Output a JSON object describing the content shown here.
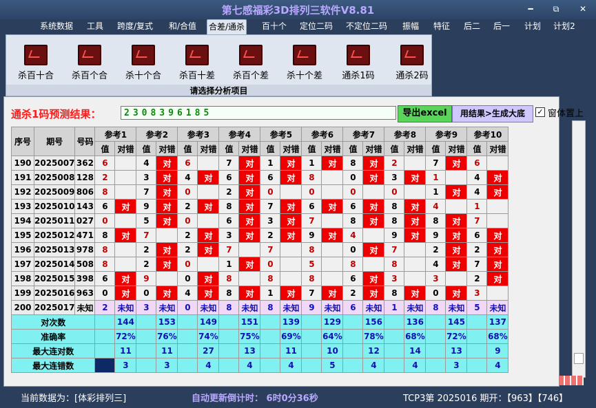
{
  "window": {
    "title": "第七感福彩3D排列三软件V8.81",
    "minimize": "━",
    "maximize": "⧉",
    "close": "✕"
  },
  "menu": [
    "系统数据",
    "工具",
    "跨度/复式",
    "和/合值",
    "合差/通杀",
    "百十个",
    "定位二码",
    "不定位二码",
    "振幅",
    "特征",
    "后二",
    "后一",
    "计划",
    "计划2"
  ],
  "active_menu": "合差/通杀",
  "tools": [
    "杀百十合",
    "杀百个合",
    "杀十个合",
    "杀百十差",
    "杀百个差",
    "杀十个差",
    "通杀1码",
    "通杀2码"
  ],
  "ribbon_caption": "请选择分析项目",
  "result": {
    "label": "通杀1码预测结果：",
    "value": "2308396185"
  },
  "buttons": {
    "excel": "导出excel",
    "generate": "用结果>生成大底"
  },
  "checkbox": {
    "label": "窗体置上",
    "checked": "✓"
  },
  "table": {
    "headers": {
      "seq": "序号",
      "period": "期号",
      "number": "号码",
      "refs": [
        "参考1",
        "参考2",
        "参考3",
        "参考4",
        "参考5",
        "参考6",
        "参考7",
        "参考8",
        "参考9",
        "参考10"
      ],
      "val": "值",
      "hit": "对错"
    },
    "rows": [
      {
        "seq": "190",
        "period": "2025007",
        "num": "362",
        "cells": [
          [
            "6",
            ""
          ],
          [
            "4",
            "对"
          ],
          [
            "6",
            ""
          ],
          [
            "7",
            "对"
          ],
          [
            "1",
            "对"
          ],
          [
            "1",
            "对"
          ],
          [
            "8",
            "对"
          ],
          [
            "2",
            ""
          ],
          [
            "7",
            "对"
          ],
          [
            "6",
            ""
          ]
        ]
      },
      {
        "seq": "191",
        "period": "2025008",
        "num": "128",
        "cells": [
          [
            "2",
            ""
          ],
          [
            "3",
            "对"
          ],
          [
            "4",
            "对"
          ],
          [
            "6",
            "对"
          ],
          [
            "6",
            "对"
          ],
          [
            "8",
            ""
          ],
          [
            "0",
            "对"
          ],
          [
            "3",
            "对"
          ],
          [
            "1",
            ""
          ],
          [
            "4",
            "对"
          ]
        ]
      },
      {
        "seq": "192",
        "period": "2025009",
        "num": "806",
        "cells": [
          [
            "8",
            ""
          ],
          [
            "7",
            "对"
          ],
          [
            "0",
            ""
          ],
          [
            "2",
            "对"
          ],
          [
            "0",
            ""
          ],
          [
            "0",
            ""
          ],
          [
            "0",
            ""
          ],
          [
            "0",
            ""
          ],
          [
            "1",
            "对"
          ],
          [
            "4",
            "对"
          ]
        ]
      },
      {
        "seq": "193",
        "period": "2025010",
        "num": "143",
        "cells": [
          [
            "6",
            "对"
          ],
          [
            "9",
            "对"
          ],
          [
            "2",
            "对"
          ],
          [
            "8",
            "对"
          ],
          [
            "7",
            "对"
          ],
          [
            "6",
            "对"
          ],
          [
            "6",
            "对"
          ],
          [
            "8",
            "对"
          ],
          [
            "4",
            ""
          ],
          [
            "1",
            ""
          ]
        ]
      },
      {
        "seq": "194",
        "period": "2025011",
        "num": "027",
        "cells": [
          [
            "0",
            ""
          ],
          [
            "5",
            "对"
          ],
          [
            "0",
            ""
          ],
          [
            "6",
            "对"
          ],
          [
            "3",
            "对"
          ],
          [
            "7",
            ""
          ],
          [
            "8",
            "对"
          ],
          [
            "8",
            "对"
          ],
          [
            "8",
            "对"
          ],
          [
            "7",
            ""
          ]
        ]
      },
      {
        "seq": "195",
        "period": "2025012",
        "num": "471",
        "cells": [
          [
            "8",
            "对"
          ],
          [
            "7",
            ""
          ],
          [
            "2",
            "对"
          ],
          [
            "3",
            "对"
          ],
          [
            "2",
            "对"
          ],
          [
            "9",
            "对"
          ],
          [
            "4",
            ""
          ],
          [
            "9",
            "对"
          ],
          [
            "9",
            "对"
          ],
          [
            "6",
            "对"
          ]
        ]
      },
      {
        "seq": "196",
        "period": "2025013",
        "num": "978",
        "cells": [
          [
            "8",
            ""
          ],
          [
            "2",
            "对"
          ],
          [
            "2",
            "对"
          ],
          [
            "7",
            ""
          ],
          [
            "7",
            ""
          ],
          [
            "8",
            ""
          ],
          [
            "0",
            "对"
          ],
          [
            "7",
            ""
          ],
          [
            "2",
            "对"
          ],
          [
            "2",
            "对"
          ]
        ]
      },
      {
        "seq": "197",
        "period": "2025014",
        "num": "508",
        "cells": [
          [
            "8",
            ""
          ],
          [
            "2",
            "对"
          ],
          [
            "0",
            ""
          ],
          [
            "1",
            "对"
          ],
          [
            "0",
            ""
          ],
          [
            "5",
            ""
          ],
          [
            "8",
            ""
          ],
          [
            "8",
            ""
          ],
          [
            "4",
            "对"
          ],
          [
            "7",
            "对"
          ]
        ]
      },
      {
        "seq": "198",
        "period": "2025015",
        "num": "398",
        "cells": [
          [
            "6",
            "对"
          ],
          [
            "9",
            ""
          ],
          [
            "0",
            "对"
          ],
          [
            "8",
            ""
          ],
          [
            "8",
            ""
          ],
          [
            "8",
            ""
          ],
          [
            "6",
            "对"
          ],
          [
            "3",
            ""
          ],
          [
            "3",
            ""
          ],
          [
            "2",
            "对"
          ]
        ]
      },
      {
        "seq": "199",
        "period": "2025016",
        "num": "963",
        "cells": [
          [
            "0",
            "对"
          ],
          [
            "0",
            "对"
          ],
          [
            "4",
            "对"
          ],
          [
            "8",
            "对"
          ],
          [
            "1",
            "对"
          ],
          [
            "7",
            "对"
          ],
          [
            "2",
            "对"
          ],
          [
            "8",
            "对"
          ],
          [
            "0",
            "对"
          ],
          [
            "3",
            ""
          ]
        ]
      }
    ],
    "predict": {
      "seq": "200",
      "period": "2025017",
      "num": "未知",
      "cells": [
        [
          "2",
          "未知"
        ],
        [
          "3",
          "未知"
        ],
        [
          "0",
          "未知"
        ],
        [
          "8",
          "未知"
        ],
        [
          "8",
          "未知"
        ],
        [
          "9",
          "未知"
        ],
        [
          "6",
          "未知"
        ],
        [
          "1",
          "未知"
        ],
        [
          "8",
          "未知"
        ],
        [
          "5",
          "未知"
        ]
      ]
    },
    "stats": [
      {
        "label": "对次数",
        "values": [
          "144",
          "153",
          "149",
          "151",
          "139",
          "129",
          "156",
          "136",
          "145",
          "137"
        ]
      },
      {
        "label": "准确率",
        "values": [
          "72%",
          "76%",
          "74%",
          "75%",
          "69%",
          "64%",
          "78%",
          "68%",
          "72%",
          "68%"
        ]
      },
      {
        "label": "最大连对数",
        "values": [
          "11",
          "11",
          "27",
          "13",
          "11",
          "10",
          "12",
          "14",
          "13",
          "9"
        ]
      },
      {
        "label": "最大连错数",
        "values": [
          "3",
          "3",
          "4",
          "4",
          "4",
          "5",
          "4",
          "4",
          "3",
          "4"
        ]
      }
    ]
  },
  "status": {
    "data_source": "当前数据为：[体彩排列三]",
    "countdown": "自动更新倒计时：  6时0分36秒",
    "latest": "TCP3第 2025016 期开：【963】【746】"
  }
}
